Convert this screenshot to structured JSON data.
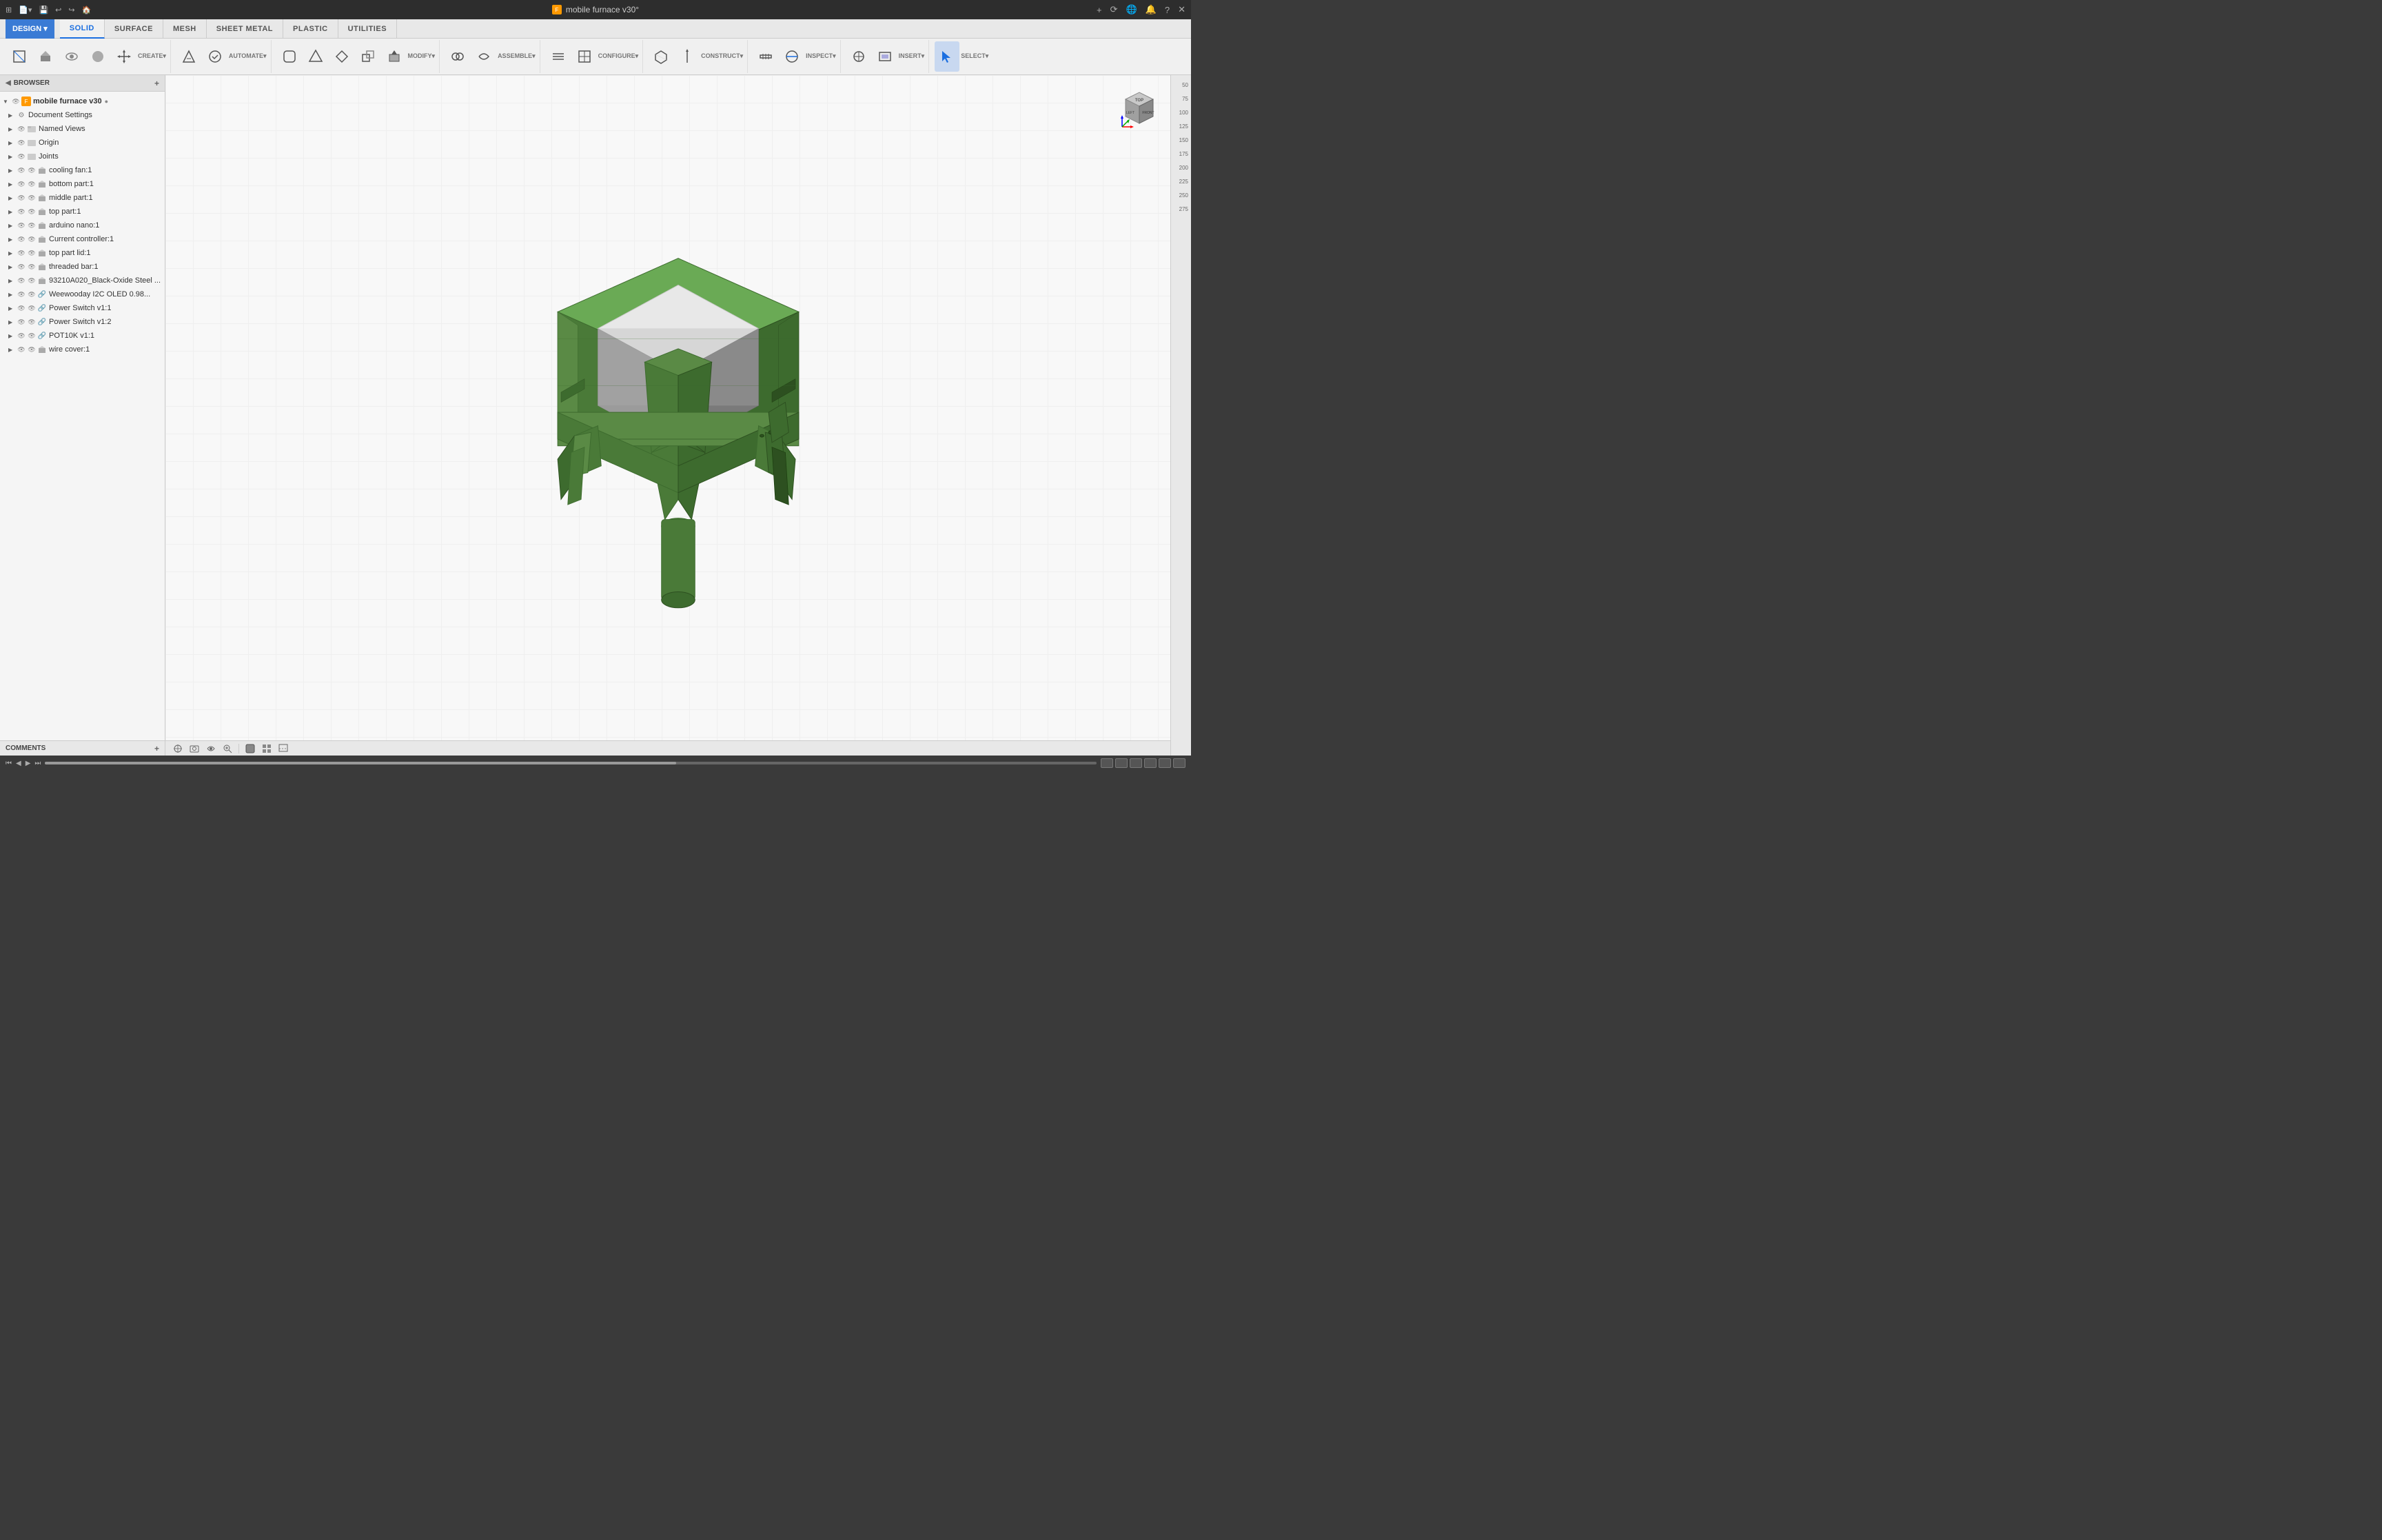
{
  "titlebar": {
    "title": "mobile furnace v30°",
    "icon_color": "#f90"
  },
  "tabs": {
    "design_label": "DESIGN ▾",
    "items": [
      {
        "label": "SOLID",
        "active": true
      },
      {
        "label": "SURFACE",
        "active": false
      },
      {
        "label": "MESH",
        "active": false
      },
      {
        "label": "SHEET METAL",
        "active": false
      },
      {
        "label": "PLASTIC",
        "active": false
      },
      {
        "label": "UTILITIES",
        "active": false
      }
    ]
  },
  "tool_groups": [
    {
      "name": "CREATE",
      "tools": [
        {
          "icon": "⬜",
          "label": ""
        },
        {
          "icon": "◼",
          "label": ""
        },
        {
          "icon": "⬡",
          "label": ""
        },
        {
          "icon": "⬤",
          "label": ""
        },
        {
          "icon": "✛",
          "label": ""
        }
      ]
    },
    {
      "name": "AUTOMATE",
      "tools": [
        {
          "icon": "✂",
          "label": ""
        },
        {
          "icon": "◇",
          "label": ""
        }
      ]
    },
    {
      "name": "MODIFY",
      "tools": [
        {
          "icon": "⬢",
          "label": ""
        },
        {
          "icon": "⬡",
          "label": ""
        },
        {
          "icon": "⬣",
          "label": ""
        },
        {
          "icon": "↕",
          "label": ""
        },
        {
          "icon": "⊕",
          "label": ""
        }
      ]
    },
    {
      "name": "ASSEMBLE",
      "tools": [
        {
          "icon": "⚙",
          "label": ""
        },
        {
          "icon": "🔗",
          "label": ""
        }
      ]
    },
    {
      "name": "CONFIGURE",
      "tools": [
        {
          "icon": "≡",
          "label": ""
        },
        {
          "icon": "⊞",
          "label": ""
        }
      ]
    },
    {
      "name": "CONSTRUCT",
      "tools": [
        {
          "icon": "◈",
          "label": ""
        },
        {
          "icon": "📐",
          "label": ""
        }
      ]
    },
    {
      "name": "INSPECT",
      "tools": [
        {
          "icon": "📏",
          "label": ""
        },
        {
          "icon": "📐",
          "label": ""
        }
      ]
    },
    {
      "name": "INSERT",
      "tools": [
        {
          "icon": "⊕",
          "label": ""
        },
        {
          "icon": "🖼",
          "label": ""
        }
      ]
    },
    {
      "name": "SELECT",
      "tools": [
        {
          "icon": "↖",
          "label": ""
        }
      ]
    }
  ],
  "browser": {
    "header": "BROWSER",
    "items": [
      {
        "indent": 0,
        "label": "mobile furnace v30",
        "type": "folder",
        "root": true
      },
      {
        "indent": 1,
        "label": "Document Settings",
        "type": "settings"
      },
      {
        "indent": 1,
        "label": "Named Views",
        "type": "folder"
      },
      {
        "indent": 1,
        "label": "Origin",
        "type": "folder"
      },
      {
        "indent": 1,
        "label": "Joints",
        "type": "folder"
      },
      {
        "indent": 1,
        "label": "cooling fan:1",
        "type": "part"
      },
      {
        "indent": 1,
        "label": "bottom part:1",
        "type": "part"
      },
      {
        "indent": 1,
        "label": "middle part:1",
        "type": "part"
      },
      {
        "indent": 1,
        "label": "top part:1",
        "type": "part"
      },
      {
        "indent": 1,
        "label": "arduino nano:1",
        "type": "part"
      },
      {
        "indent": 1,
        "label": "Current controller:1",
        "type": "part"
      },
      {
        "indent": 1,
        "label": "top part lid:1",
        "type": "part"
      },
      {
        "indent": 1,
        "label": "threaded bar:1",
        "type": "part"
      },
      {
        "indent": 1,
        "label": "93210A020_Black-Oxide Steel ...",
        "type": "part"
      },
      {
        "indent": 1,
        "label": "Weewooday I2C OLED 0.98...",
        "type": "link"
      },
      {
        "indent": 1,
        "label": "Power Switch v1:1",
        "type": "link"
      },
      {
        "indent": 1,
        "label": "Power Switch v1:2",
        "type": "link"
      },
      {
        "indent": 1,
        "label": "POT10K v1:1",
        "type": "link"
      },
      {
        "indent": 1,
        "label": "wire cover:1",
        "type": "part"
      }
    ]
  },
  "comments": {
    "label": "COMMENTS"
  },
  "ruler": {
    "marks": [
      "50",
      "75",
      "100",
      "125",
      "150",
      "175",
      "200",
      "225",
      "250",
      "275"
    ]
  },
  "bottom_toolbar": {
    "tools": [
      "⊕",
      "📋",
      "✋",
      "🔍",
      "Q",
      "◼",
      "▦",
      "⊞"
    ]
  },
  "timeline": {
    "controls": [
      "⏮",
      "◀",
      "▶",
      "⏭"
    ]
  }
}
